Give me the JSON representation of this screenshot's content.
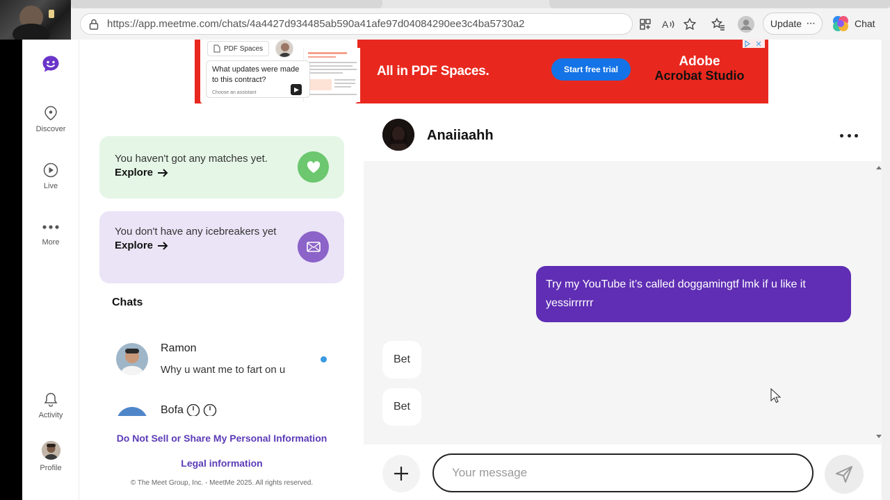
{
  "browser": {
    "url": "https://app.meetme.com/chats/4a4427d934485ab590a41afe97d04084290ee3c4ba5730a2",
    "update_label": "Update",
    "copilot_label": "Chat"
  },
  "sidebar": {
    "items": [
      {
        "label": "Discover"
      },
      {
        "label": "Live"
      },
      {
        "label": "More"
      },
      {
        "label": "Activity"
      },
      {
        "label": "Profile"
      }
    ]
  },
  "ad": {
    "pill": "PDF Spaces",
    "question": "What updates were made to this contract?",
    "assistant": "Choose an assistant",
    "headline": "All in PDF Spaces.",
    "cta": "Start free trial",
    "brand_line1": "Adobe",
    "brand_line2": "Acrobat Studio"
  },
  "cards": {
    "matches": {
      "text": "You haven't got any matches yet.",
      "link": "Explore"
    },
    "icebreakers": {
      "text": "You don't have any icebreakers yet",
      "link": "Explore"
    }
  },
  "chats": {
    "title": "Chats",
    "list": [
      {
        "name": "Ramon",
        "preview": "Why u want me to fart on u",
        "unread": true
      },
      {
        "name": "Bofa",
        "preview": "",
        "unread": false
      }
    ]
  },
  "footer": {
    "dns": "Do Not Sell or Share My Personal Information",
    "legal": "Legal information",
    "copyright": "© The Meet Group, Inc. - MeetMe 2025. All rights reserved."
  },
  "conversation": {
    "name": "Anaiiaahh",
    "messages": [
      {
        "direction": "out",
        "text": "Try my YouTube it’s called doggamingtf lmk if u like it yessirrrrrr"
      },
      {
        "direction": "in",
        "text": "Bet"
      },
      {
        "direction": "in",
        "text": "Bet"
      }
    ],
    "input_placeholder": "Your message"
  },
  "colors": {
    "brand": "#5f2eb4",
    "match_card": "#e5f6e6",
    "match_icon": "#6cc76f",
    "icebreaker_card": "#ebe4f7",
    "icebreaker_icon": "#8c63c8",
    "ad_bg": "#e8281e",
    "ad_cta": "#1473e6",
    "unread_dot": "#3b9ae1"
  }
}
